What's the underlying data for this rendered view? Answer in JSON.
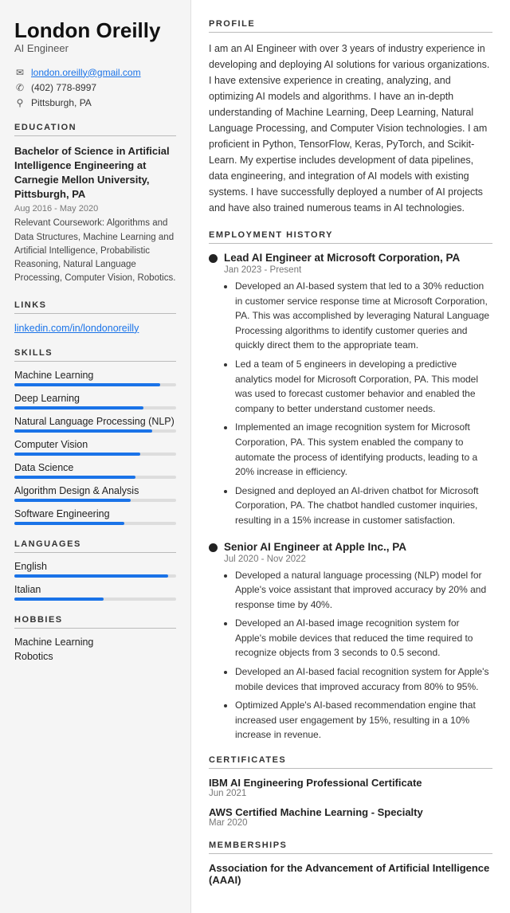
{
  "sidebar": {
    "name": "London Oreilly",
    "title": "AI Engineer",
    "contact": {
      "email": "london.oreilly@gmail.com",
      "phone": "(402) 778-8997",
      "location": "Pittsburgh, PA"
    },
    "education": {
      "degree": "Bachelor of Science in Artificial Intelligence Engineering at Carnegie Mellon University, Pittsburgh, PA",
      "dates": "Aug 2016 - May 2020",
      "coursework": "Relevant Coursework: Algorithms and Data Structures, Machine Learning and Artificial Intelligence, Probabilistic Reasoning, Natural Language Processing, Computer Vision, Robotics."
    },
    "links": {
      "label": "LINKS",
      "linkedin": "linkedin.com/in/londonoreilly"
    },
    "skills_label": "SKILLS",
    "skills": [
      {
        "name": "Machine Learning",
        "pct": 90
      },
      {
        "name": "Deep Learning",
        "pct": 80
      },
      {
        "name": "Natural Language Processing (NLP)",
        "pct": 85
      },
      {
        "name": "Computer Vision",
        "pct": 78
      },
      {
        "name": "Data Science",
        "pct": 75
      },
      {
        "name": "Algorithm Design & Analysis",
        "pct": 72
      },
      {
        "name": "Software Engineering",
        "pct": 68
      }
    ],
    "languages_label": "LANGUAGES",
    "languages": [
      {
        "name": "English",
        "pct": 95
      },
      {
        "name": "Italian",
        "pct": 55
      }
    ],
    "hobbies_label": "HOBBIES",
    "hobbies": [
      "Machine Learning",
      "Robotics"
    ]
  },
  "main": {
    "profile_label": "PROFILE",
    "profile_text": "I am an AI Engineer with over 3 years of industry experience in developing and deploying AI solutions for various organizations. I have extensive experience in creating, analyzing, and optimizing AI models and algorithms. I have an in-depth understanding of Machine Learning, Deep Learning, Natural Language Processing, and Computer Vision technologies. I am proficient in Python, TensorFlow, Keras, PyTorch, and Scikit-Learn. My expertise includes development of data pipelines, data engineering, and integration of AI models with existing systems. I have successfully deployed a number of AI projects and have also trained numerous teams in AI technologies.",
    "employment_label": "EMPLOYMENT HISTORY",
    "jobs": [
      {
        "title": "Lead AI Engineer at Microsoft Corporation, PA",
        "dates": "Jan 2023 - Present",
        "bullets": [
          "Developed an AI-based system that led to a 30% reduction in customer service response time at Microsoft Corporation, PA. This was accomplished by leveraging Natural Language Processing algorithms to identify customer queries and quickly direct them to the appropriate team.",
          "Led a team of 5 engineers in developing a predictive analytics model for Microsoft Corporation, PA. This model was used to forecast customer behavior and enabled the company to better understand customer needs.",
          "Implemented an image recognition system for Microsoft Corporation, PA. This system enabled the company to automate the process of identifying products, leading to a 20% increase in efficiency.",
          "Designed and deployed an AI-driven chatbot for Microsoft Corporation, PA. The chatbot handled customer inquiries, resulting in a 15% increase in customer satisfaction."
        ]
      },
      {
        "title": "Senior AI Engineer at Apple Inc., PA",
        "dates": "Jul 2020 - Nov 2022",
        "bullets": [
          "Developed a natural language processing (NLP) model for Apple's voice assistant that improved accuracy by 20% and response time by 40%.",
          "Developed an AI-based image recognition system for Apple's mobile devices that reduced the time required to recognize objects from 3 seconds to 0.5 second.",
          "Developed an AI-based facial recognition system for Apple's mobile devices that improved accuracy from 80% to 95%.",
          "Optimized Apple's AI-based recommendation engine that increased user engagement by 15%, resulting in a 10% increase in revenue."
        ]
      }
    ],
    "certificates_label": "CERTIFICATES",
    "certificates": [
      {
        "name": "IBM AI Engineering Professional Certificate",
        "date": "Jun 2021"
      },
      {
        "name": "AWS Certified Machine Learning - Specialty",
        "date": "Mar 2020"
      }
    ],
    "memberships_label": "MEMBERSHIPS",
    "memberships": [
      {
        "name": "Association for the Advancement of Artificial Intelligence (AAAI)"
      }
    ]
  }
}
